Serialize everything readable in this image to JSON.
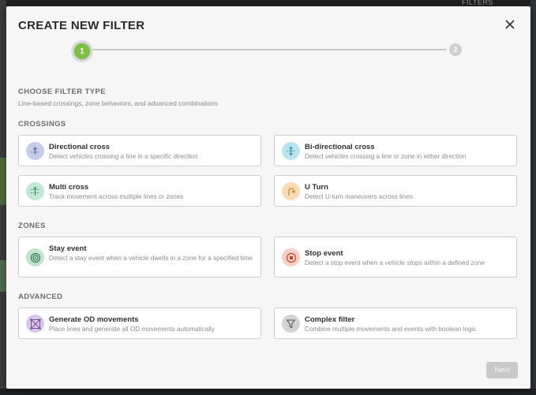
{
  "background": {
    "filters_label": "FILTERS"
  },
  "modal": {
    "title": "CREATE NEW FILTER",
    "steps": [
      "1",
      "2"
    ]
  },
  "choose": {
    "title": "CHOOSE FILTER TYPE",
    "subtitle": "Line-based crossings, zone behaviors, and advanced combinations"
  },
  "crossings": {
    "title": "CROSSINGS",
    "items": [
      {
        "title": "Directional cross",
        "desc": "Detect vehicles crossing a line in a specific direction",
        "icon": "arrow-up-line-icon",
        "color": "#c6cdea"
      },
      {
        "title": "Bi-directional cross",
        "desc": "Detect vehicles crossing a line or zone in either direction",
        "icon": "arrow-updown-line-icon",
        "color": "#b9e4ec"
      },
      {
        "title": "Multi cross",
        "desc": "Track movement across multiple lines or zones",
        "icon": "multi-line-icon",
        "color": "#c3e7d5"
      },
      {
        "title": "U Turn",
        "desc": "Detect U-turn maneuvers across lines",
        "icon": "u-turn-icon",
        "color": "#f7dcb5"
      }
    ]
  },
  "zones": {
    "title": "ZONES",
    "items": [
      {
        "title": "Stay event",
        "desc": "Detect a stay event when a vehicle dwells in a zone for a specified time",
        "icon": "target-icon",
        "color": "#c3e3cf"
      },
      {
        "title": "Stop event",
        "desc": "Detect a stop event when a vehicle stops within a defined zone",
        "icon": "stop-icon",
        "color": "#f6cfc5"
      }
    ]
  },
  "advanced": {
    "title": "ADVANCED",
    "items": [
      {
        "title": "Generate OD movements",
        "desc": "Place lines and generate all OD movements automatically",
        "icon": "od-grid-icon",
        "color": "#d9c7e8"
      },
      {
        "title": "Complex filter",
        "desc": "Combine multiple movements and events with boolean logic",
        "icon": "funnel-icon",
        "color": "#d3d3d3"
      }
    ]
  },
  "footer": {
    "next_label": "Next"
  }
}
